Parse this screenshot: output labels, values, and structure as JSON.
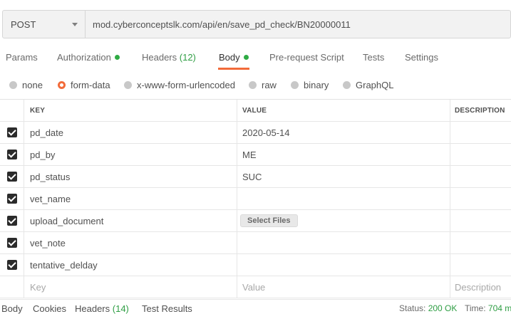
{
  "request": {
    "method": "POST",
    "url": "mod.cyberconceptslk.com/api/en/save_pd_check/BN20000011"
  },
  "tabs": [
    {
      "label": "Params"
    },
    {
      "label": "Authorization"
    },
    {
      "label": "Headers",
      "count": "(12)"
    },
    {
      "label": "Body"
    },
    {
      "label": "Pre-request Script"
    },
    {
      "label": "Tests"
    },
    {
      "label": "Settings"
    }
  ],
  "active_tab": "Body",
  "body_types": [
    {
      "label": "none"
    },
    {
      "label": "form-data"
    },
    {
      "label": "x-www-form-urlencoded"
    },
    {
      "label": "raw"
    },
    {
      "label": "binary"
    },
    {
      "label": "GraphQL"
    }
  ],
  "selected_body_type": "form-data",
  "table": {
    "headers": {
      "key": "KEY",
      "value": "VALUE",
      "description": "DESCRIPTION"
    },
    "rows": [
      {
        "key": "pd_date",
        "value": "2020-05-14",
        "checked": true
      },
      {
        "key": "pd_by",
        "value": "ME",
        "checked": true
      },
      {
        "key": "pd_status",
        "value": "SUC",
        "checked": true
      },
      {
        "key": "vet_name",
        "value": "",
        "checked": true
      },
      {
        "key": "upload_document",
        "value": "",
        "file_button": "Select Files",
        "checked": true
      },
      {
        "key": "vet_note",
        "value": "",
        "checked": true
      },
      {
        "key": "tentative_delday",
        "value": "",
        "checked": true
      }
    ],
    "placeholders": {
      "key": "Key",
      "value": "Value",
      "description": "Description"
    }
  },
  "response": {
    "tabs": [
      {
        "label": "Body"
      },
      {
        "label": "Cookies"
      },
      {
        "label": "Headers",
        "count": "(14)"
      },
      {
        "label": "Test Results"
      }
    ],
    "status_label": "Status:",
    "status_value": "200 OK",
    "time_label": "Time:",
    "time_value": "704 m"
  },
  "colors": {
    "accent": "#f26b3a",
    "success": "#2f9e44",
    "indicator_dot": "#2fab44"
  }
}
